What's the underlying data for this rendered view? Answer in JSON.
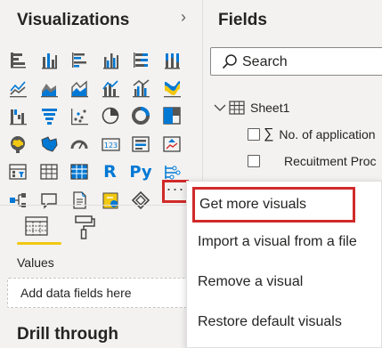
{
  "visualizations": {
    "title": "Visualizations",
    "expand_icon": "chevron-right-icon",
    "gallery": [
      {
        "name": "stacked-bar-chart-icon"
      },
      {
        "name": "stacked-column-chart-icon"
      },
      {
        "name": "clustered-bar-chart-icon"
      },
      {
        "name": "clustered-column-chart-icon"
      },
      {
        "name": "100-stacked-bar-chart-icon"
      },
      {
        "name": "100-stacked-column-chart-icon"
      },
      {
        "name": "line-chart-icon"
      },
      {
        "name": "area-chart-icon"
      },
      {
        "name": "stacked-area-chart-icon"
      },
      {
        "name": "line-and-column-chart-icon"
      },
      {
        "name": "line-and-clustered-column-chart-icon"
      },
      {
        "name": "ribbon-chart-icon"
      },
      {
        "name": "waterfall-chart-icon"
      },
      {
        "name": "funnel-chart-icon"
      },
      {
        "name": "scatter-chart-icon"
      },
      {
        "name": "pie-chart-icon"
      },
      {
        "name": "donut-chart-icon"
      },
      {
        "name": "treemap-icon"
      },
      {
        "name": "map-icon"
      },
      {
        "name": "filled-map-icon"
      },
      {
        "name": "gauge-icon"
      },
      {
        "name": "card-icon"
      },
      {
        "name": "multi-row-card-icon"
      },
      {
        "name": "kpi-icon"
      },
      {
        "name": "slicer-icon"
      },
      {
        "name": "table-icon"
      },
      {
        "name": "matrix-icon"
      },
      {
        "name": "r-visual-icon",
        "label": "R"
      },
      {
        "name": "python-visual-icon",
        "label": "Py"
      },
      {
        "name": "key-influencers-icon"
      },
      {
        "name": "decomposition-tree-icon"
      },
      {
        "name": "qa-icon"
      },
      {
        "name": "smart-narrative-icon"
      },
      {
        "name": "paginated-report-icon"
      },
      {
        "name": "power-apps-icon"
      }
    ],
    "more_visuals_label": "···",
    "fields_tab_icon": "build-visual-icon",
    "format_tab_icon": "paint-roller-icon",
    "values_label": "Values",
    "add_fields_placeholder": "Add data fields here",
    "drill_through_title": "Drill through",
    "highlight_color": "#d12a2a",
    "tab_accent": "#f2c811"
  },
  "fields": {
    "title": "Fields",
    "search_placeholder": "Search",
    "table": {
      "name": "Sheet1",
      "expanded": true
    },
    "items": [
      {
        "label": "No. of application",
        "type": "sigma"
      },
      {
        "label": "Recuitment Proc",
        "type": "text"
      }
    ]
  },
  "context_menu": {
    "items": [
      {
        "label": "Get more visuals",
        "highlighted": true
      },
      {
        "label": "Import a visual from a file"
      },
      {
        "label": "Remove a visual"
      },
      {
        "label": "Restore default visuals"
      }
    ]
  }
}
